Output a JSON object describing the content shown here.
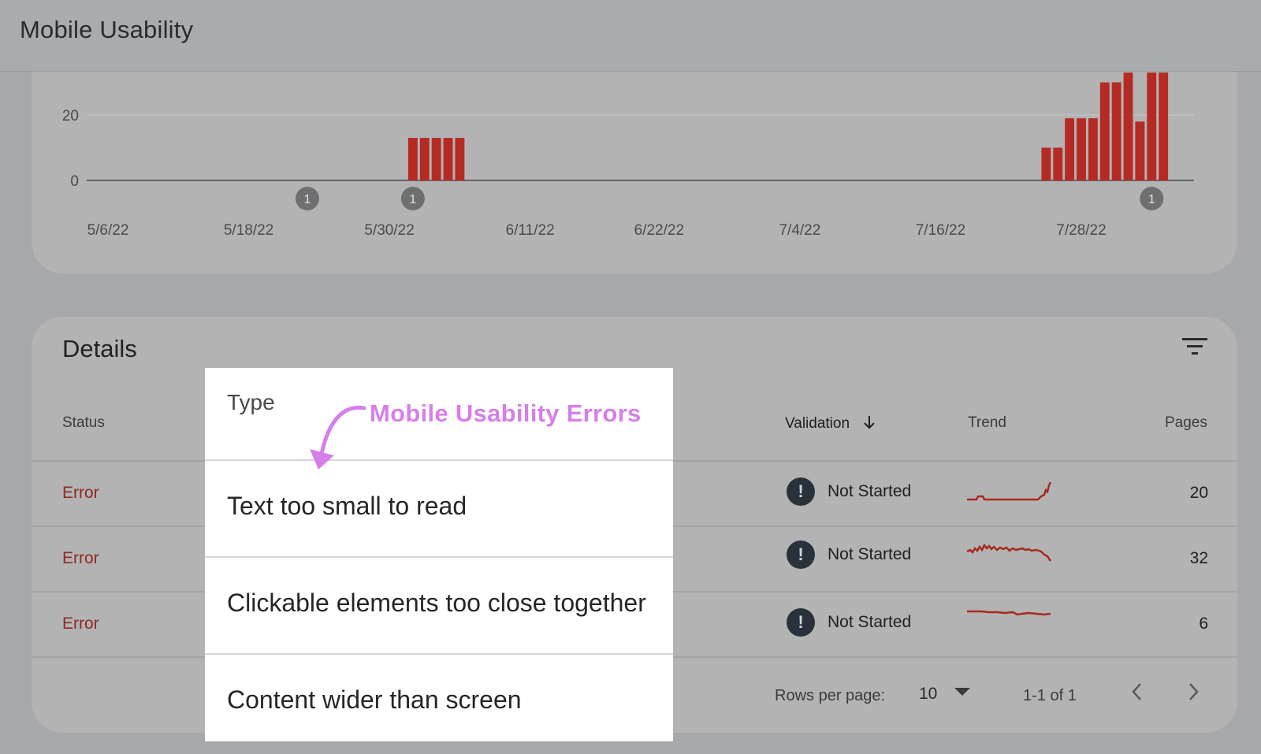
{
  "header": {
    "title": "Mobile Usability"
  },
  "chart_data": {
    "type": "bar",
    "ytick_labels": [
      "20",
      "0"
    ],
    "xtick_labels": [
      "5/6/22",
      "5/18/22",
      "5/30/22",
      "6/11/22",
      "6/22/22",
      "7/4/22",
      "7/16/22",
      "7/28/22"
    ],
    "bars": [
      {
        "date": "6/1/22",
        "value": 13
      },
      {
        "date": "6/2/22",
        "value": 13
      },
      {
        "date": "6/3/22",
        "value": 13
      },
      {
        "date": "6/4/22",
        "value": 13
      },
      {
        "date": "6/5/22",
        "value": 13
      },
      {
        "date": "7/25/22",
        "value": 10
      },
      {
        "date": "7/26/22",
        "value": 10
      },
      {
        "date": "7/27/22",
        "value": 19
      },
      {
        "date": "7/28/22",
        "value": 19
      },
      {
        "date": "7/29/22",
        "value": 19
      },
      {
        "date": "7/30/22",
        "value": 30
      },
      {
        "date": "7/31/22",
        "value": 30
      },
      {
        "date": "8/1/22",
        "value": 33
      },
      {
        "date": "8/2/22",
        "value": 18
      },
      {
        "date": "8/3/22",
        "value": 33
      },
      {
        "date": "8/4/22",
        "value": 33
      }
    ],
    "event_markers": [
      {
        "date": "5/23/22",
        "label": "1"
      },
      {
        "date": "6/1/22",
        "label": "1"
      },
      {
        "date": "8/3/22",
        "label": "1"
      }
    ],
    "bar_color": "#b52a22",
    "grid": true
  },
  "details": {
    "title": "Details",
    "columns": {
      "status": "Status",
      "type": "Type",
      "validation": "Validation",
      "trend": "Trend",
      "pages": "Pages"
    },
    "rows": [
      {
        "status": "Error",
        "type": "Text too small to read",
        "validation": "Not Started",
        "pages": "20"
      },
      {
        "status": "Error",
        "type": "Clickable elements too close together",
        "validation": "Not Started",
        "pages": "32"
      },
      {
        "status": "Error",
        "type": "Content wider than screen",
        "validation": "Not Started",
        "pages": "6"
      }
    ],
    "warning_glyph": "!",
    "footer": {
      "rows_per_page_label": "Rows per page:",
      "rows_per_page_value": "10",
      "page_range": "1-1 of 1"
    }
  },
  "annotation": {
    "text": "Mobile Usability Errors",
    "color": "#d67fe9"
  },
  "icons": {
    "filter": "filter-icon",
    "sort": "arrow-down-icon",
    "warning": "exclamation-icon",
    "dropdown": "caret-down-icon",
    "prev": "chevron-left-icon",
    "next": "chevron-right-icon"
  },
  "colors": {
    "error_text": "#8d2a22",
    "trend_line": "#a52a1e",
    "warning_badge": "#29323a"
  }
}
